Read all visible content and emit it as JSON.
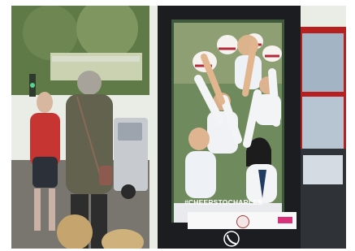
{
  "billboard": {
    "hashtag": "#CHEERSTOCHARLES",
    "logo_left": "",
    "logo_right": ""
  },
  "colors": {
    "kiosk": "#1b1d21",
    "sky": "#e9ede6",
    "bus_red": "#b81f1f",
    "street": "#7e7c76"
  },
  "icons": {
    "phone": "phone-icon",
    "traffic_light": "traffic-light-icon"
  }
}
